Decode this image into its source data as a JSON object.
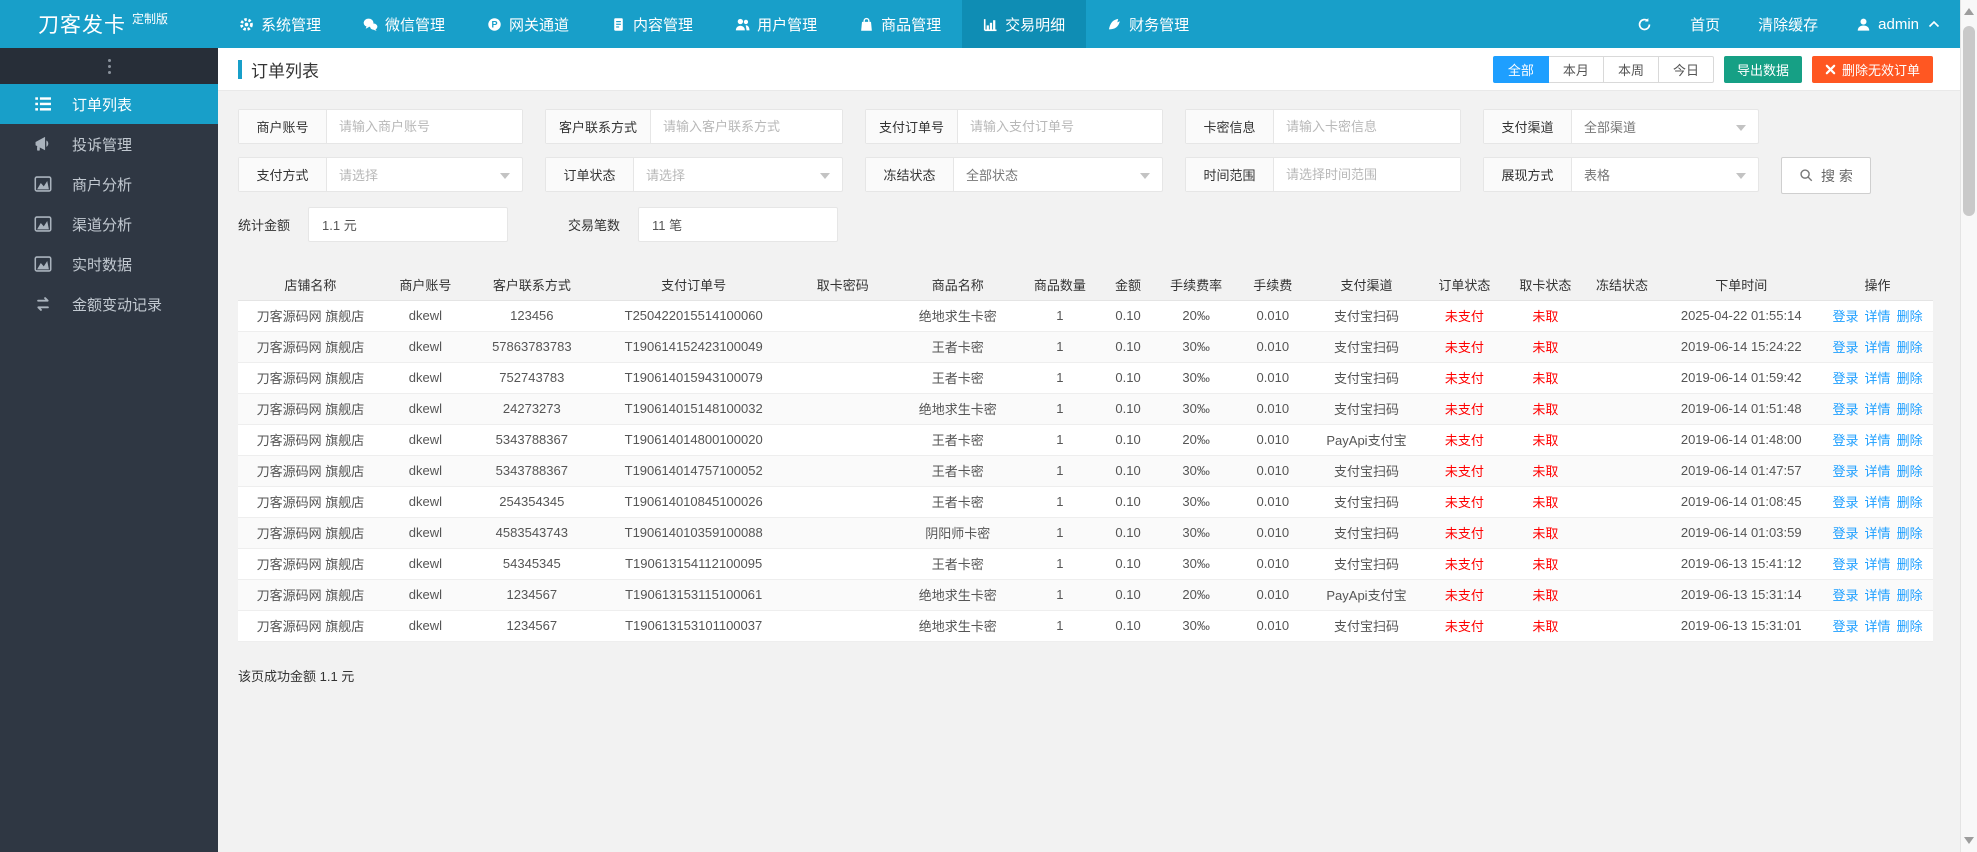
{
  "brand": {
    "title": "刀客发卡",
    "badge": "定制版"
  },
  "topnav": {
    "items": [
      {
        "label": "系统管理",
        "icon": "gear-icon",
        "active": false
      },
      {
        "label": "微信管理",
        "icon": "wechat-icon",
        "active": false
      },
      {
        "label": "网关通道",
        "icon": "gateway-icon",
        "active": false
      },
      {
        "label": "内容管理",
        "icon": "document-icon",
        "active": false
      },
      {
        "label": "用户管理",
        "icon": "users-icon",
        "active": false
      },
      {
        "label": "商品管理",
        "icon": "shopping-bag-icon",
        "active": false
      },
      {
        "label": "交易明细",
        "icon": "bar-chart-icon",
        "active": true
      },
      {
        "label": "财务管理",
        "icon": "finance-icon",
        "active": false
      }
    ],
    "right": {
      "refresh_icon": "refresh-icon",
      "home": "首页",
      "clear_cache": "清除缓存",
      "user": "admin",
      "user_icon": "user-icon",
      "chevron_icon": "chevron-up-icon"
    }
  },
  "sidebar": {
    "items": [
      {
        "label": "订单列表",
        "icon": "ordered-list-icon",
        "active": true
      },
      {
        "label": "投诉管理",
        "icon": "megaphone-icon",
        "active": false
      },
      {
        "label": "商户分析",
        "icon": "area-chart-icon",
        "active": false
      },
      {
        "label": "渠道分析",
        "icon": "area-chart-icon",
        "active": false
      },
      {
        "label": "实时数据",
        "icon": "area-chart-icon",
        "active": false
      },
      {
        "label": "金额变动记录",
        "icon": "transfer-icon",
        "active": false
      }
    ]
  },
  "page": {
    "title": "订单列表",
    "range_tabs": [
      {
        "label": "全部",
        "active": true
      },
      {
        "label": "本月",
        "active": false
      },
      {
        "label": "本周",
        "active": false
      },
      {
        "label": "今日",
        "active": false
      }
    ],
    "export_button": "导出数据",
    "delete_button": "删除无效订单"
  },
  "filters": {
    "row1": [
      {
        "label": "商户账号",
        "type": "input",
        "placeholder": "请输入商户账号"
      },
      {
        "label": "客户联系方式",
        "type": "input",
        "placeholder": "请输入客户联系方式"
      },
      {
        "label": "支付订单号",
        "type": "input",
        "placeholder": "请输入支付订单号"
      },
      {
        "label": "卡密信息",
        "type": "input",
        "placeholder": "请输入卡密信息"
      },
      {
        "label": "支付渠道",
        "type": "select",
        "value": "全部渠道",
        "is_placeholder": false
      }
    ],
    "row2": [
      {
        "label": "支付方式",
        "type": "select",
        "value": "请选择",
        "is_placeholder": true
      },
      {
        "label": "订单状态",
        "type": "select",
        "value": "请选择",
        "is_placeholder": true
      },
      {
        "label": "冻结状态",
        "type": "select",
        "value": "全部状态",
        "is_placeholder": false
      },
      {
        "label": "时间范围",
        "type": "input",
        "placeholder": "请选择时间范围"
      },
      {
        "label": "展现方式",
        "type": "select",
        "value": "表格",
        "is_placeholder": false
      }
    ],
    "search_button": "搜 索",
    "stats": [
      {
        "label": "统计金额",
        "value": "1.1 元"
      },
      {
        "label": "交易笔数",
        "value": "11 笔"
      }
    ]
  },
  "table": {
    "columns": [
      "店铺名称",
      "商户账号",
      "客户联系方式",
      "支付订单号",
      "取卡密码",
      "商品名称",
      "商品数量",
      "金额",
      "手续费率",
      "手续费",
      "支付渠道",
      "订单状态",
      "取卡状态",
      "冻结状态",
      "下单时间",
      "操作"
    ],
    "row_actions": [
      "登录",
      "详情",
      "删除"
    ],
    "rows": [
      [
        "刀客源码网 旗舰店",
        "dkewl",
        "123456",
        "T250422015514100060",
        "",
        "绝地求生卡密",
        "1",
        "0.10",
        "20‰",
        "0.010",
        "支付宝扫码",
        "未支付",
        "未取",
        "",
        "2025-04-22 01:55:14"
      ],
      [
        "刀客源码网 旗舰店",
        "dkewl",
        "57863783783",
        "T190614152423100049",
        "",
        "王者卡密",
        "1",
        "0.10",
        "30‰",
        "0.010",
        "支付宝扫码",
        "未支付",
        "未取",
        "",
        "2019-06-14 15:24:22"
      ],
      [
        "刀客源码网 旗舰店",
        "dkewl",
        "752743783",
        "T190614015943100079",
        "",
        "王者卡密",
        "1",
        "0.10",
        "30‰",
        "0.010",
        "支付宝扫码",
        "未支付",
        "未取",
        "",
        "2019-06-14 01:59:42"
      ],
      [
        "刀客源码网 旗舰店",
        "dkewl",
        "24273273",
        "T190614015148100032",
        "",
        "绝地求生卡密",
        "1",
        "0.10",
        "30‰",
        "0.010",
        "支付宝扫码",
        "未支付",
        "未取",
        "",
        "2019-06-14 01:51:48"
      ],
      [
        "刀客源码网 旗舰店",
        "dkewl",
        "5343788367",
        "T190614014800100020",
        "",
        "王者卡密",
        "1",
        "0.10",
        "20‰",
        "0.010",
        "PayApi支付宝",
        "未支付",
        "未取",
        "",
        "2019-06-14 01:48:00"
      ],
      [
        "刀客源码网 旗舰店",
        "dkewl",
        "5343788367",
        "T190614014757100052",
        "",
        "王者卡密",
        "1",
        "0.10",
        "30‰",
        "0.010",
        "支付宝扫码",
        "未支付",
        "未取",
        "",
        "2019-06-14 01:47:57"
      ],
      [
        "刀客源码网 旗舰店",
        "dkewl",
        "254354345",
        "T190614010845100026",
        "",
        "王者卡密",
        "1",
        "0.10",
        "30‰",
        "0.010",
        "支付宝扫码",
        "未支付",
        "未取",
        "",
        "2019-06-14 01:08:45"
      ],
      [
        "刀客源码网 旗舰店",
        "dkewl",
        "4583543743",
        "T190614010359100088",
        "",
        "阴阳师卡密",
        "1",
        "0.10",
        "30‰",
        "0.010",
        "支付宝扫码",
        "未支付",
        "未取",
        "",
        "2019-06-14 01:03:59"
      ],
      [
        "刀客源码网 旗舰店",
        "dkewl",
        "54345345",
        "T190613154112100095",
        "",
        "王者卡密",
        "1",
        "0.10",
        "30‰",
        "0.010",
        "支付宝扫码",
        "未支付",
        "未取",
        "",
        "2019-06-13 15:41:12"
      ],
      [
        "刀客源码网 旗舰店",
        "dkewl",
        "1234567",
        "T190613153115100061",
        "",
        "绝地求生卡密",
        "1",
        "0.10",
        "20‰",
        "0.010",
        "PayApi支付宝",
        "未支付",
        "未取",
        "",
        "2019-06-13 15:31:14"
      ],
      [
        "刀客源码网 旗舰店",
        "dkewl",
        "1234567",
        "T190613153101100037",
        "",
        "绝地求生卡密",
        "1",
        "0.10",
        "30‰",
        "0.010",
        "支付宝扫码",
        "未支付",
        "未取",
        "",
        "2019-06-13 15:31:01"
      ]
    ]
  },
  "footer": {
    "summary": "该页成功金额 1.1 元"
  },
  "colors": {
    "header": "#189fc9",
    "header_active": "#0f8db4",
    "sidebar": "#2f3743",
    "sidebar_strip": "#272e38",
    "active_blue": "#1e9fff",
    "teal": "#16a085",
    "orange": "#ff5722",
    "link": "#1e9fff",
    "red": "#ff0000"
  }
}
